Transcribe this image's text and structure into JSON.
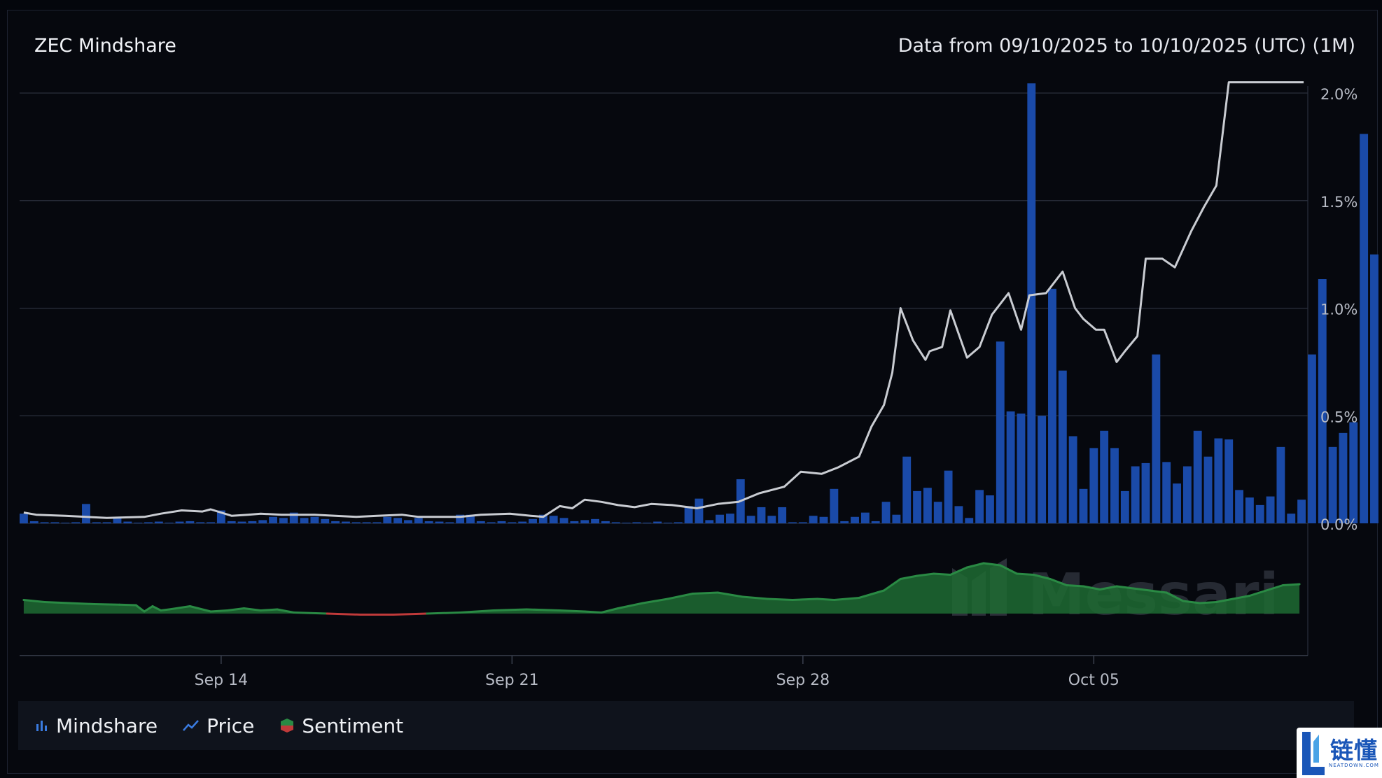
{
  "header": {
    "title": "ZEC Mindshare",
    "date_range": "Data from 09/10/2025 to 10/10/2025 (UTC) (1M)"
  },
  "watermark": "Messari",
  "brand": {
    "name": "链懂",
    "sub": "NEATDOWN.COM"
  },
  "legend": {
    "mindshare": "Mindshare",
    "price": "Price",
    "sentiment": "Sentiment"
  },
  "colors": {
    "mindshare_bar": "#1a4aa8",
    "price_line": "#c9ccd2",
    "sentiment_positive": "#2a8a44",
    "sentiment_negative": "#c03a3a",
    "grid": "#2a2f3c",
    "axis_text": "#b8bcc6"
  },
  "chart_data": {
    "type": "bar",
    "title": "ZEC Mindshare",
    "x_ticks": [
      "Sep 14",
      "Sep 21",
      "Sep 28",
      "Oct 05"
    ],
    "x_tick_positions": [
      6.25,
      13.25,
      20.25,
      27.25
    ],
    "y_ticks": [
      "0.0%",
      "0.5%",
      "1.0%",
      "1.5%",
      "2.0%"
    ],
    "ylim": [
      0,
      2.0
    ],
    "xlim": [
      1.4,
      32.4
    ],
    "grid": true,
    "legend": "bottom-left",
    "series": [
      {
        "name": "Mindshare",
        "type": "bar",
        "interval_days": 0.25,
        "start": 1.5,
        "values": [
          0.045,
          0.01,
          0.005,
          0.005,
          0.003,
          0.005,
          0.09,
          0.005,
          0.005,
          0.03,
          0.008,
          0.003,
          0.005,
          0.008,
          0.003,
          0.008,
          0.01,
          0.005,
          0.005,
          0.06,
          0.01,
          0.008,
          0.01,
          0.015,
          0.03,
          0.025,
          0.05,
          0.025,
          0.03,
          0.02,
          0.01,
          0.008,
          0.005,
          0.005,
          0.005,
          0.03,
          0.025,
          0.015,
          0.025,
          0.01,
          0.008,
          0.005,
          0.04,
          0.04,
          0.01,
          0.005,
          0.01,
          0.005,
          0.008,
          0.02,
          0.04,
          0.035,
          0.025,
          0.01,
          0.015,
          0.02,
          0.01,
          0.005,
          0.003,
          0.005,
          0.003,
          0.008,
          0.003,
          0.005,
          0.08,
          0.115,
          0.015,
          0.04,
          0.045,
          0.205,
          0.035,
          0.075,
          0.035,
          0.075,
          0.005,
          0.005,
          0.035,
          0.03,
          0.16,
          0.01,
          0.03,
          0.05,
          0.01,
          0.1,
          0.04,
          0.31,
          0.15,
          0.165,
          0.1,
          0.245,
          0.08,
          0.025,
          0.155,
          0.13,
          0.845,
          0.52,
          0.51,
          2.045,
          0.5,
          1.09,
          0.71,
          0.405,
          0.16,
          0.35,
          0.43,
          0.35,
          0.15,
          0.265,
          0.28,
          0.785,
          0.285,
          0.185,
          0.265,
          0.43,
          0.31,
          0.395,
          0.39,
          0.155,
          0.12,
          0.085,
          0.125,
          0.355,
          0.045,
          0.11,
          0.785,
          1.135,
          0.355,
          0.42,
          0.47,
          1.81,
          1.25
        ]
      },
      {
        "name": "Price",
        "type": "line",
        "x": [
          1.5,
          1.8,
          2.5,
          3.5,
          4.4,
          4.8,
          5.3,
          5.8,
          6.0,
          6.5,
          6.9,
          7.2,
          7.7,
          8.5,
          9.0,
          9.5,
          10.0,
          10.6,
          11.0,
          11.6,
          12.0,
          12.5,
          13.2,
          13.7,
          14.0,
          14.4,
          14.7,
          15.0,
          15.4,
          15.8,
          16.2,
          16.6,
          17.1,
          17.7,
          18.2,
          18.7,
          19.2,
          19.8,
          20.2,
          20.7,
          21.1,
          21.6,
          21.9,
          22.2,
          22.4,
          22.6,
          22.9,
          23.2,
          23.3,
          23.6,
          23.8,
          24.2,
          24.5,
          24.8,
          25.2,
          25.5,
          25.7,
          26.1,
          26.5,
          26.8,
          27.0,
          27.3,
          27.5,
          27.8,
          28.0,
          28.3,
          28.5,
          28.9,
          29.2,
          29.6,
          29.9,
          30.2,
          30.5,
          30.8,
          30.9,
          31.1,
          31.3,
          31.5,
          31.8,
          32.0,
          32.2,
          32.3
        ],
        "values": [
          0.05,
          0.04,
          0.035,
          0.025,
          0.03,
          0.045,
          0.06,
          0.055,
          0.065,
          0.035,
          0.04,
          0.045,
          0.04,
          0.04,
          0.035,
          0.03,
          0.035,
          0.04,
          0.03,
          0.03,
          0.03,
          0.04,
          0.045,
          0.035,
          0.03,
          0.08,
          0.07,
          0.11,
          0.1,
          0.085,
          0.075,
          0.09,
          0.085,
          0.07,
          0.09,
          0.1,
          0.14,
          0.17,
          0.24,
          0.23,
          0.26,
          0.31,
          0.45,
          0.55,
          0.7,
          1.0,
          0.85,
          0.76,
          0.8,
          0.82,
          0.99,
          0.77,
          0.82,
          0.97,
          1.07,
          0.9,
          1.06,
          1.07,
          1.17,
          1.0,
          0.95,
          0.9,
          0.9,
          0.75,
          0.8,
          0.87,
          1.23,
          1.23,
          1.19,
          1.36,
          1.47,
          1.57,
          2.05,
          2.05,
          2.05,
          2.05,
          2.05,
          2.05,
          2.05,
          2.05,
          2.05,
          2.05
        ]
      },
      {
        "name": "Sentiment",
        "type": "area",
        "x": [
          1.5,
          2.0,
          2.6,
          3.2,
          3.8,
          4.2,
          4.4,
          4.6,
          4.8,
          5.0,
          5.5,
          6.0,
          6.4,
          6.8,
          7.2,
          7.6,
          8.0,
          8.8,
          9.6,
          10.4,
          11.2,
          12.0,
          12.8,
          13.6,
          14.4,
          15.0,
          15.4,
          15.8,
          16.4,
          17.0,
          17.6,
          18.2,
          18.8,
          19.4,
          20.0,
          20.6,
          21.0,
          21.6,
          22.2,
          22.6,
          23.0,
          23.4,
          23.8,
          24.2,
          24.6,
          25.0,
          25.4,
          25.8,
          26.2,
          26.6,
          27.0,
          27.4,
          27.8,
          28.2,
          28.6,
          29.0,
          29.4,
          29.8,
          30.2,
          30.6,
          31.0,
          31.4,
          31.8,
          32.2
        ],
        "values": [
          0.13,
          0.11,
          0.1,
          0.09,
          0.085,
          0.08,
          0.02,
          0.07,
          0.03,
          0.04,
          0.07,
          0.02,
          0.03,
          0.05,
          0.03,
          0.04,
          0.01,
          0.0,
          -0.01,
          -0.01,
          0.0,
          0.01,
          0.03,
          0.04,
          0.03,
          0.02,
          0.01,
          0.05,
          0.1,
          0.14,
          0.19,
          0.2,
          0.16,
          0.14,
          0.13,
          0.14,
          0.13,
          0.15,
          0.22,
          0.33,
          0.36,
          0.38,
          0.37,
          0.44,
          0.48,
          0.46,
          0.38,
          0.37,
          0.33,
          0.27,
          0.26,
          0.23,
          0.26,
          0.24,
          0.22,
          0.2,
          0.12,
          0.1,
          0.11,
          0.14,
          0.17,
          0.22,
          0.27,
          0.28
        ]
      }
    ]
  }
}
